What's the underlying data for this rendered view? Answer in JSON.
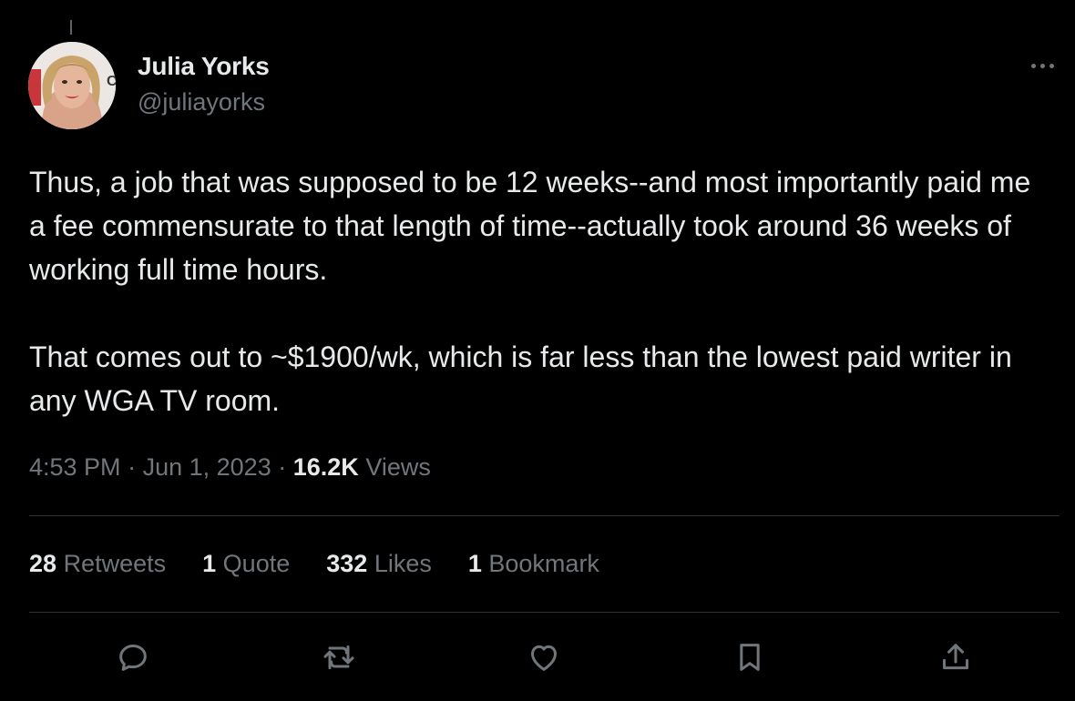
{
  "author": {
    "name": "Julia Yorks",
    "handle": "@juliayorks"
  },
  "tweet": {
    "paragraphs": [
      "Thus, a job that was supposed to be 12 weeks--and most importantly paid me a fee commensurate to that length of time--actually took around 36 weeks of working full time hours.",
      "That comes out to ~$1900/wk, which is far less than the lowest paid writer in any WGA TV room."
    ]
  },
  "meta": {
    "time": "4:53 PM",
    "separator": "·",
    "date": "Jun 1, 2023",
    "views_count": "16.2K",
    "views_label": "Views"
  },
  "stats": {
    "retweets": {
      "count": "28",
      "label": "Retweets"
    },
    "quotes": {
      "count": "1",
      "label": "Quote"
    },
    "likes": {
      "count": "332",
      "label": "Likes"
    },
    "bookmarks": {
      "count": "1",
      "label": "Bookmark"
    }
  },
  "icons": {
    "more": "more-horizontal-icon",
    "reply": "reply-icon",
    "retweet": "retweet-icon",
    "like": "heart-icon",
    "bookmark": "bookmark-icon",
    "share": "share-icon"
  },
  "colors": {
    "background": "#000000",
    "text_primary": "#e7e9ea",
    "text_secondary": "#71767b",
    "divider": "#2f3336"
  }
}
